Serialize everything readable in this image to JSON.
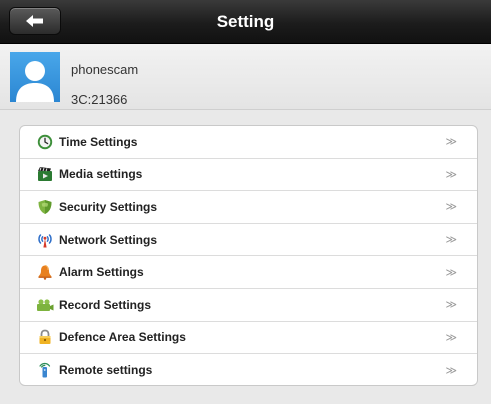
{
  "header": {
    "title": "Setting",
    "back_icon": "back-arrow-icon"
  },
  "profile": {
    "name": "phonescam",
    "id": "3C:21366",
    "avatar_icon": "user-avatar-icon"
  },
  "menu": {
    "chevron": "≫",
    "items": [
      {
        "label": "Time Settings",
        "icon": "clock-icon"
      },
      {
        "label": "Media settings",
        "icon": "media-icon"
      },
      {
        "label": "Security Settings",
        "icon": "shield-icon"
      },
      {
        "label": "Network Settings",
        "icon": "antenna-icon"
      },
      {
        "label": "Alarm Settings",
        "icon": "alarm-bell-icon"
      },
      {
        "label": "Record Settings",
        "icon": "record-icon"
      },
      {
        "label": "Defence Area Settings",
        "icon": "lock-icon"
      },
      {
        "label": "Remote settings",
        "icon": "remote-icon"
      }
    ]
  },
  "colors": {
    "header_bg": "#1c1c1c",
    "avatar_bg": "#2b86d2",
    "page_bg": "#e9e9e9"
  }
}
